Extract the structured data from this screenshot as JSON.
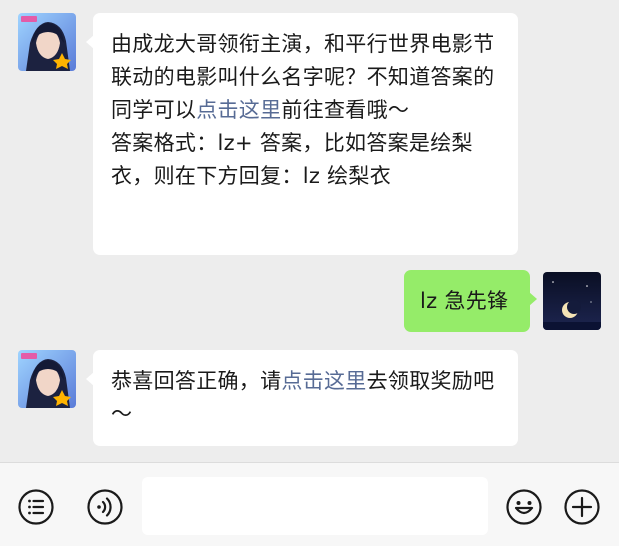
{
  "messages": [
    {
      "sender": "official-account",
      "avatar": "game-character-avatar",
      "paragraphs": [
        [
          {
            "text": "由成龙大哥领衔主演，和平行世界电影节联动的电影叫什么名字呢？不知道答案的同学可以"
          },
          {
            "text": "点击这里",
            "link": true
          },
          {
            "text": "前往查看哦～"
          }
        ],
        [
          {
            "text": "答案格式：lz+ 答案，比如答案是绘梨衣，则在下方回复：lz 绘梨衣"
          }
        ]
      ]
    },
    {
      "sender": "me",
      "avatar": "crescent-moon-avatar",
      "text": "lz 急先锋"
    },
    {
      "sender": "official-account",
      "avatar": "game-character-avatar",
      "paragraphs": [
        [
          {
            "text": "恭喜回答正确，请"
          },
          {
            "text": "点击这里",
            "link": true
          },
          {
            "text": "去领取奖励吧～"
          }
        ]
      ]
    }
  ],
  "toolbar": {
    "left_icons": [
      "menu-list-icon",
      "voice-icon"
    ],
    "input_value": "",
    "right_icons": [
      "emoji-icon",
      "plus-icon"
    ]
  },
  "colors": {
    "background": "#ededed",
    "incoming_bubble": "#ffffff",
    "outgoing_bubble": "#95ec69",
    "link": "#576b95",
    "toolbar": "#f7f7f7"
  }
}
